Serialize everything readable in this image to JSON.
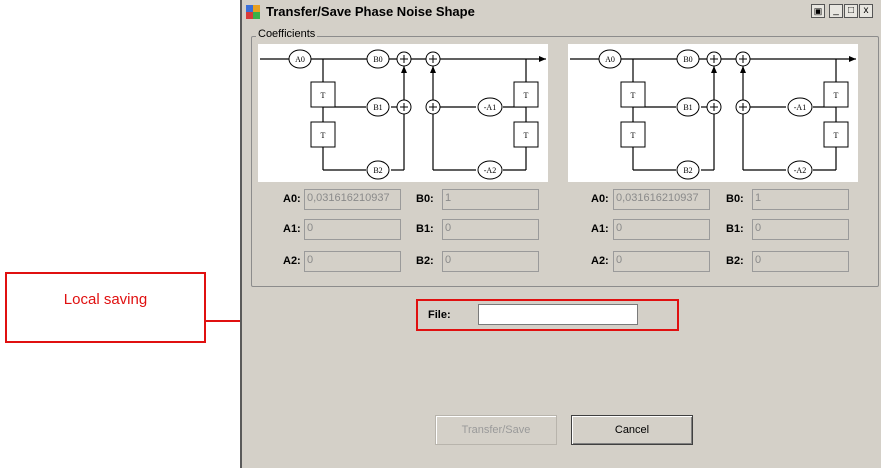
{
  "window": {
    "title": "Transfer/Save Phase Noise Shape",
    "minimize": "_",
    "maximize": "□",
    "close": "x"
  },
  "coefficients": {
    "group_label": "Coefficients",
    "left": {
      "A0": {
        "label": "A0:",
        "value": "0,031616210937"
      },
      "A1": {
        "label": "A1:",
        "value": "0"
      },
      "A2": {
        "label": "A2:",
        "value": "0"
      },
      "B0": {
        "label": "B0:",
        "value": "1"
      },
      "B1": {
        "label": "B1:",
        "value": "0"
      },
      "B2": {
        "label": "B2:",
        "value": "0"
      }
    },
    "right": {
      "A0": {
        "label": "A0:",
        "value": "0,031616210937"
      },
      "A1": {
        "label": "A1:",
        "value": "0"
      },
      "A2": {
        "label": "A2:",
        "value": "0"
      },
      "B0": {
        "label": "B0:",
        "value": "1"
      },
      "B1": {
        "label": "B1:",
        "value": "0"
      },
      "B2": {
        "label": "B2:",
        "value": "0"
      }
    },
    "diagram": {
      "A0": "A0",
      "B0": "B0",
      "B1": "B1",
      "B2": "B2",
      "mA1": "-A1",
      "mA2": "-A2",
      "T": "T"
    }
  },
  "file": {
    "label": "File:",
    "value": ""
  },
  "buttons": {
    "transfer_save": "Transfer/Save",
    "cancel": "Cancel"
  },
  "annotation": {
    "callout": "Local saving",
    "color": "#e01010"
  }
}
